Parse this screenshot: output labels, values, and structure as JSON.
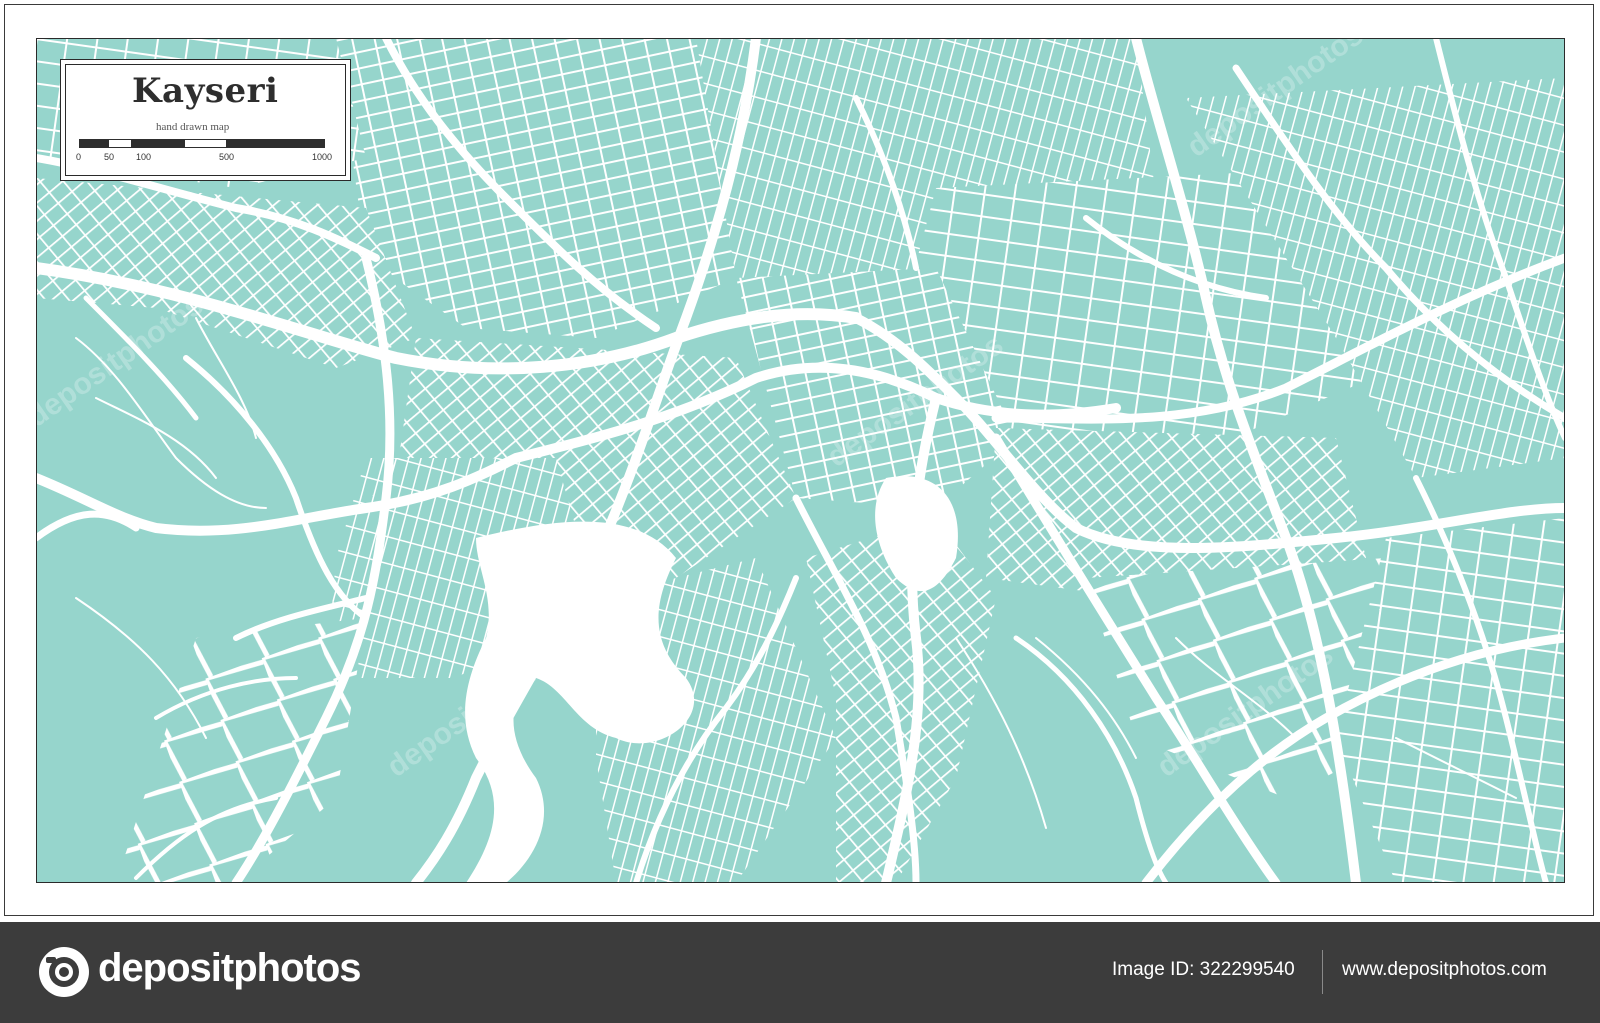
{
  "colors": {
    "land": "#96d5cc",
    "road": "#ffffff",
    "outline": "#2a2a2a",
    "watermark_bar": "#3c3c3c"
  },
  "legend": {
    "title": "Kayseri",
    "subtitle": "hand drawn map",
    "scale_labels": [
      "0",
      "50",
      "100",
      "500",
      "1000"
    ]
  },
  "watermark": {
    "brand": "depositphotos",
    "image_id": "Image ID: 322299540",
    "url": "www.depositphotos.com",
    "logo_icon": "camera-aperture-icon"
  }
}
